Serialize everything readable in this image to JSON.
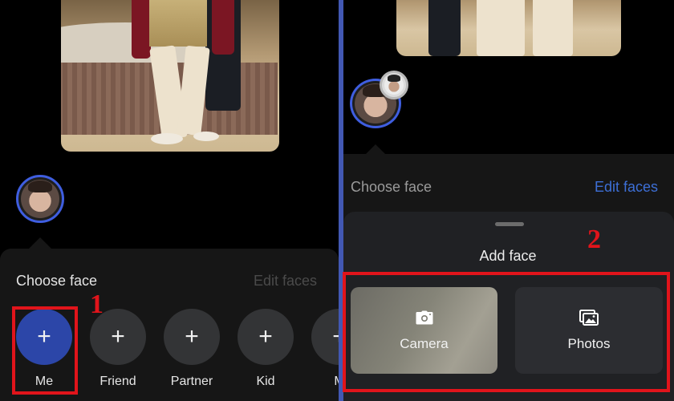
{
  "left": {
    "choose_face": "Choose face",
    "edit_faces": "Edit faces",
    "options": [
      {
        "label": "Me",
        "symbol": "+"
      },
      {
        "label": "Friend",
        "symbol": "+"
      },
      {
        "label": "Partner",
        "symbol": "+"
      },
      {
        "label": "Kid",
        "symbol": "+"
      },
      {
        "label": "M",
        "symbol": "+"
      }
    ]
  },
  "right": {
    "choose_face": "Choose face",
    "edit_faces": "Edit faces",
    "add_face": "Add face",
    "camera_label": "Camera",
    "photos_label": "Photos"
  },
  "annotations": {
    "num1": "1",
    "num2": "2"
  },
  "icons": {
    "camera": "camera-icon",
    "photos": "photos-icon"
  },
  "colors": {
    "accent_blue": "#3f5ee0",
    "me_button": "#2c46a8",
    "edit_faces_active": "#3d6fd6",
    "edit_faces_disabled": "#4a4a4a",
    "annotation_red": "#e1141b",
    "divider": "#4258b3"
  }
}
